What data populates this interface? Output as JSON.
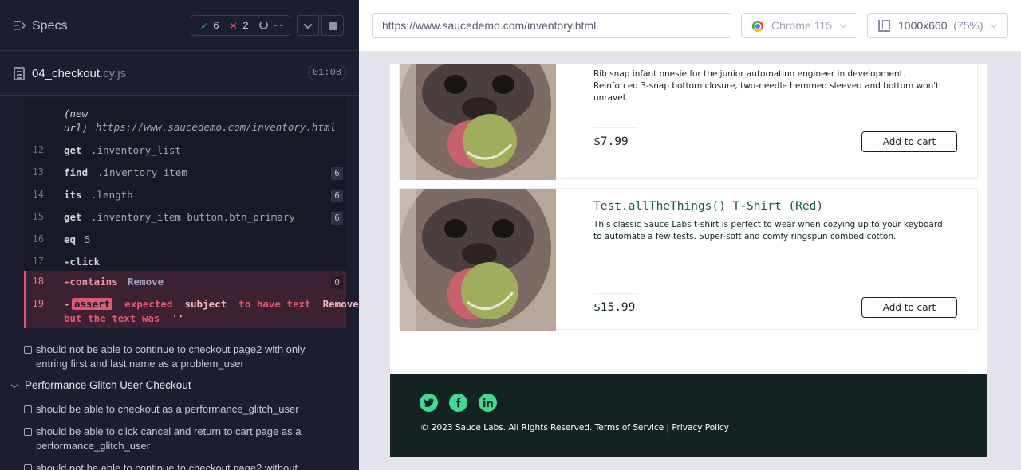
{
  "reporter": {
    "specs_label": "Specs",
    "stats": {
      "passed": "6",
      "failed": "2",
      "pending": "--"
    },
    "file": {
      "name": "04_checkout",
      "ext": ".cy.js",
      "time": "01:08"
    },
    "commands": [
      {
        "num": "",
        "name": "(new url)",
        "msg": "https://www.saucedemo.com/inventory.html",
        "badge": ""
      },
      {
        "num": "12",
        "name": "get",
        "msg": ".inventory_list",
        "badge": ""
      },
      {
        "num": "13",
        "name": "find",
        "msg": ".inventory_item",
        "badge": "6"
      },
      {
        "num": "14",
        "name": "its",
        "msg": ".length",
        "badge": "6"
      },
      {
        "num": "15",
        "name": "get",
        "msg": ".inventory_item button.btn_primary",
        "badge": "6"
      },
      {
        "num": "16",
        "name": "eq",
        "msg": "5",
        "badge": ""
      },
      {
        "num": "17",
        "name": "-click",
        "msg": "",
        "badge": ""
      },
      {
        "num": "18",
        "name": "-contains",
        "msg": "Remove",
        "badge": "0"
      },
      {
        "num": "19",
        "name": "-",
        "assert": "assert",
        "expected": "expected",
        "subject": "subject",
        "to_have_text": "to have text",
        "remove": "Remove",
        "comma": ",",
        "but": "but the text was",
        "empty": "''"
      }
    ],
    "tests": [
      {
        "label": "should not be able to continue to checkout page2 with only entring first and last name as a problem_user"
      }
    ],
    "suite": {
      "label": "Performance Glitch User Checkout"
    },
    "suite_tests": [
      {
        "label": "should be able to checkout as a performance_glitch_user"
      },
      {
        "label": "should be able to click cancel and return to cart page as a performance_glitch_user"
      },
      {
        "label": "should not be able to continue to checkout page2 without"
      }
    ]
  },
  "aut": {
    "url": "https://www.saucedemo.com/inventory.html",
    "browser": "Chrome 115",
    "viewport": "1000x660",
    "viewport_pct": "(75%)",
    "products": [
      {
        "name": "",
        "desc": "Rib snap infant onesie for the junior automation engineer in development. Reinforced 3-snap bottom closure, two-needle hemmed sleeved and bottom won't unravel.",
        "price": "$7.99",
        "button": "Add to cart"
      },
      {
        "name": "Test.allTheThings() T-Shirt (Red)",
        "desc": "This classic Sauce Labs t-shirt is perfect to wear when cozying up to your keyboard to automate a few tests. Super-soft and comfy ringspun combed cotton.",
        "price": "$15.99",
        "button": "Add to cart"
      }
    ],
    "footer": {
      "social": [
        "twitter-icon",
        "facebook-icon",
        "linkedin-icon"
      ],
      "copyright": "© 2023 Sauce Labs. All Rights Reserved. Terms of Service | Privacy Policy"
    },
    "colors": {
      "accent": "#3ddc91",
      "footer_bg": "#132322",
      "fail": "#e45770",
      "pass": "#1fa971"
    }
  }
}
